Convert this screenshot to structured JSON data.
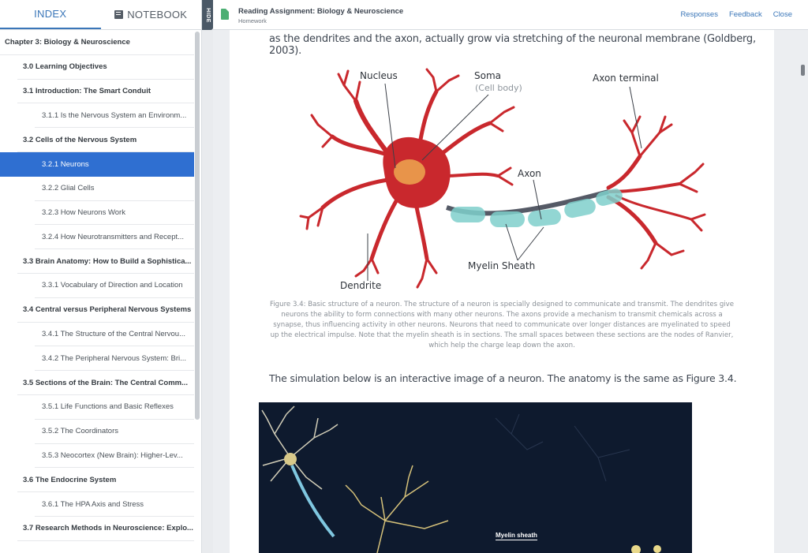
{
  "tabs": {
    "index": "INDEX",
    "notebook": "NOTEBOOK"
  },
  "hide_label": "HIDE",
  "header": {
    "title": "Reading Assignment: Biology & Neuroscience",
    "subtitle": "Homework",
    "links": {
      "responses": "Responses",
      "feedback": "Feedback",
      "close": "Close"
    }
  },
  "toc": [
    {
      "label": "Chapter 3: Biology & Neuroscience",
      "level": 0
    },
    {
      "label": "3.0 Learning Objectives",
      "level": 1
    },
    {
      "label": "3.1 Introduction: The Smart Conduit",
      "level": 1
    },
    {
      "label": "3.1.1 Is the Nervous System an Environm...",
      "level": 2
    },
    {
      "label": "3.2 Cells of the Nervous System",
      "level": 1
    },
    {
      "label": "3.2.1 Neurons",
      "level": 2,
      "selected": true
    },
    {
      "label": "3.2.2 Glial Cells",
      "level": 2
    },
    {
      "label": "3.2.3 How Neurons Work",
      "level": 2
    },
    {
      "label": "3.2.4 How Neurotransmitters and Recept...",
      "level": 2
    },
    {
      "label": "3.3 Brain Anatomy: How to Build a Sophistica...",
      "level": 1
    },
    {
      "label": "3.3.1 Vocabulary of Direction and Location",
      "level": 2
    },
    {
      "label": "3.4 Central versus Peripheral Nervous Systems",
      "level": 1
    },
    {
      "label": "3.4.1 The Structure of the Central Nervou...",
      "level": 2
    },
    {
      "label": "3.4.2 The Peripheral Nervous System: Bri...",
      "level": 2
    },
    {
      "label": "3.5 Sections of the Brain: The Central Comm...",
      "level": 1
    },
    {
      "label": "3.5.1 Life Functions and Basic Reflexes",
      "level": 2
    },
    {
      "label": "3.5.2 The Coordinators",
      "level": 2
    },
    {
      "label": "3.5.3 Neocortex (New Brain): Higher-Lev...",
      "level": 2
    },
    {
      "label": "3.6 The Endocrine System",
      "level": 1
    },
    {
      "label": "3.6.1 The HPA Axis and Stress",
      "level": 2
    },
    {
      "label": "3.7 Research Methods in Neuroscience: Explo...",
      "level": 1
    }
  ],
  "content": {
    "top_text": "as the dendrites and the axon, actually grow via stretching of the neuronal membrane (Goldberg, 2003).",
    "figure_labels": {
      "nucleus": "Nucleus",
      "soma": "Soma",
      "cell_body": "(Cell body)",
      "axon_terminal": "Axon terminal",
      "axon": "Axon",
      "myelin_sheath": "Myelin Sheath",
      "dendrite": "Dendrite"
    },
    "caption": "Figure 3.4: Basic structure of a neuron. The structure of a neuron is specially designed to communicate and transmit. The dendrites give neurons the ability to form connections with many other neurons. The axons provide a mechanism to transmit chemicals across a synapse, thus influencing activity in other neurons. Neurons that need to communicate over longer distances are myelinated to speed up the electrical impulse. Note that the myelin sheath is in sections. The small spaces between these sections are the nodes of Ranvier, which help the charge leap down the axon.",
    "sim_text": "The simulation below is an interactive image of a neuron. The anatomy is the same as Figure 3.4.",
    "sim_label": "Myelin sheath"
  },
  "colors": {
    "accent": "#2f6fd1",
    "neuron": "#c9282d",
    "nucleus": "#e8944a",
    "myelin": "#7fd0cc",
    "sim_bg": "#0e1a2e"
  }
}
